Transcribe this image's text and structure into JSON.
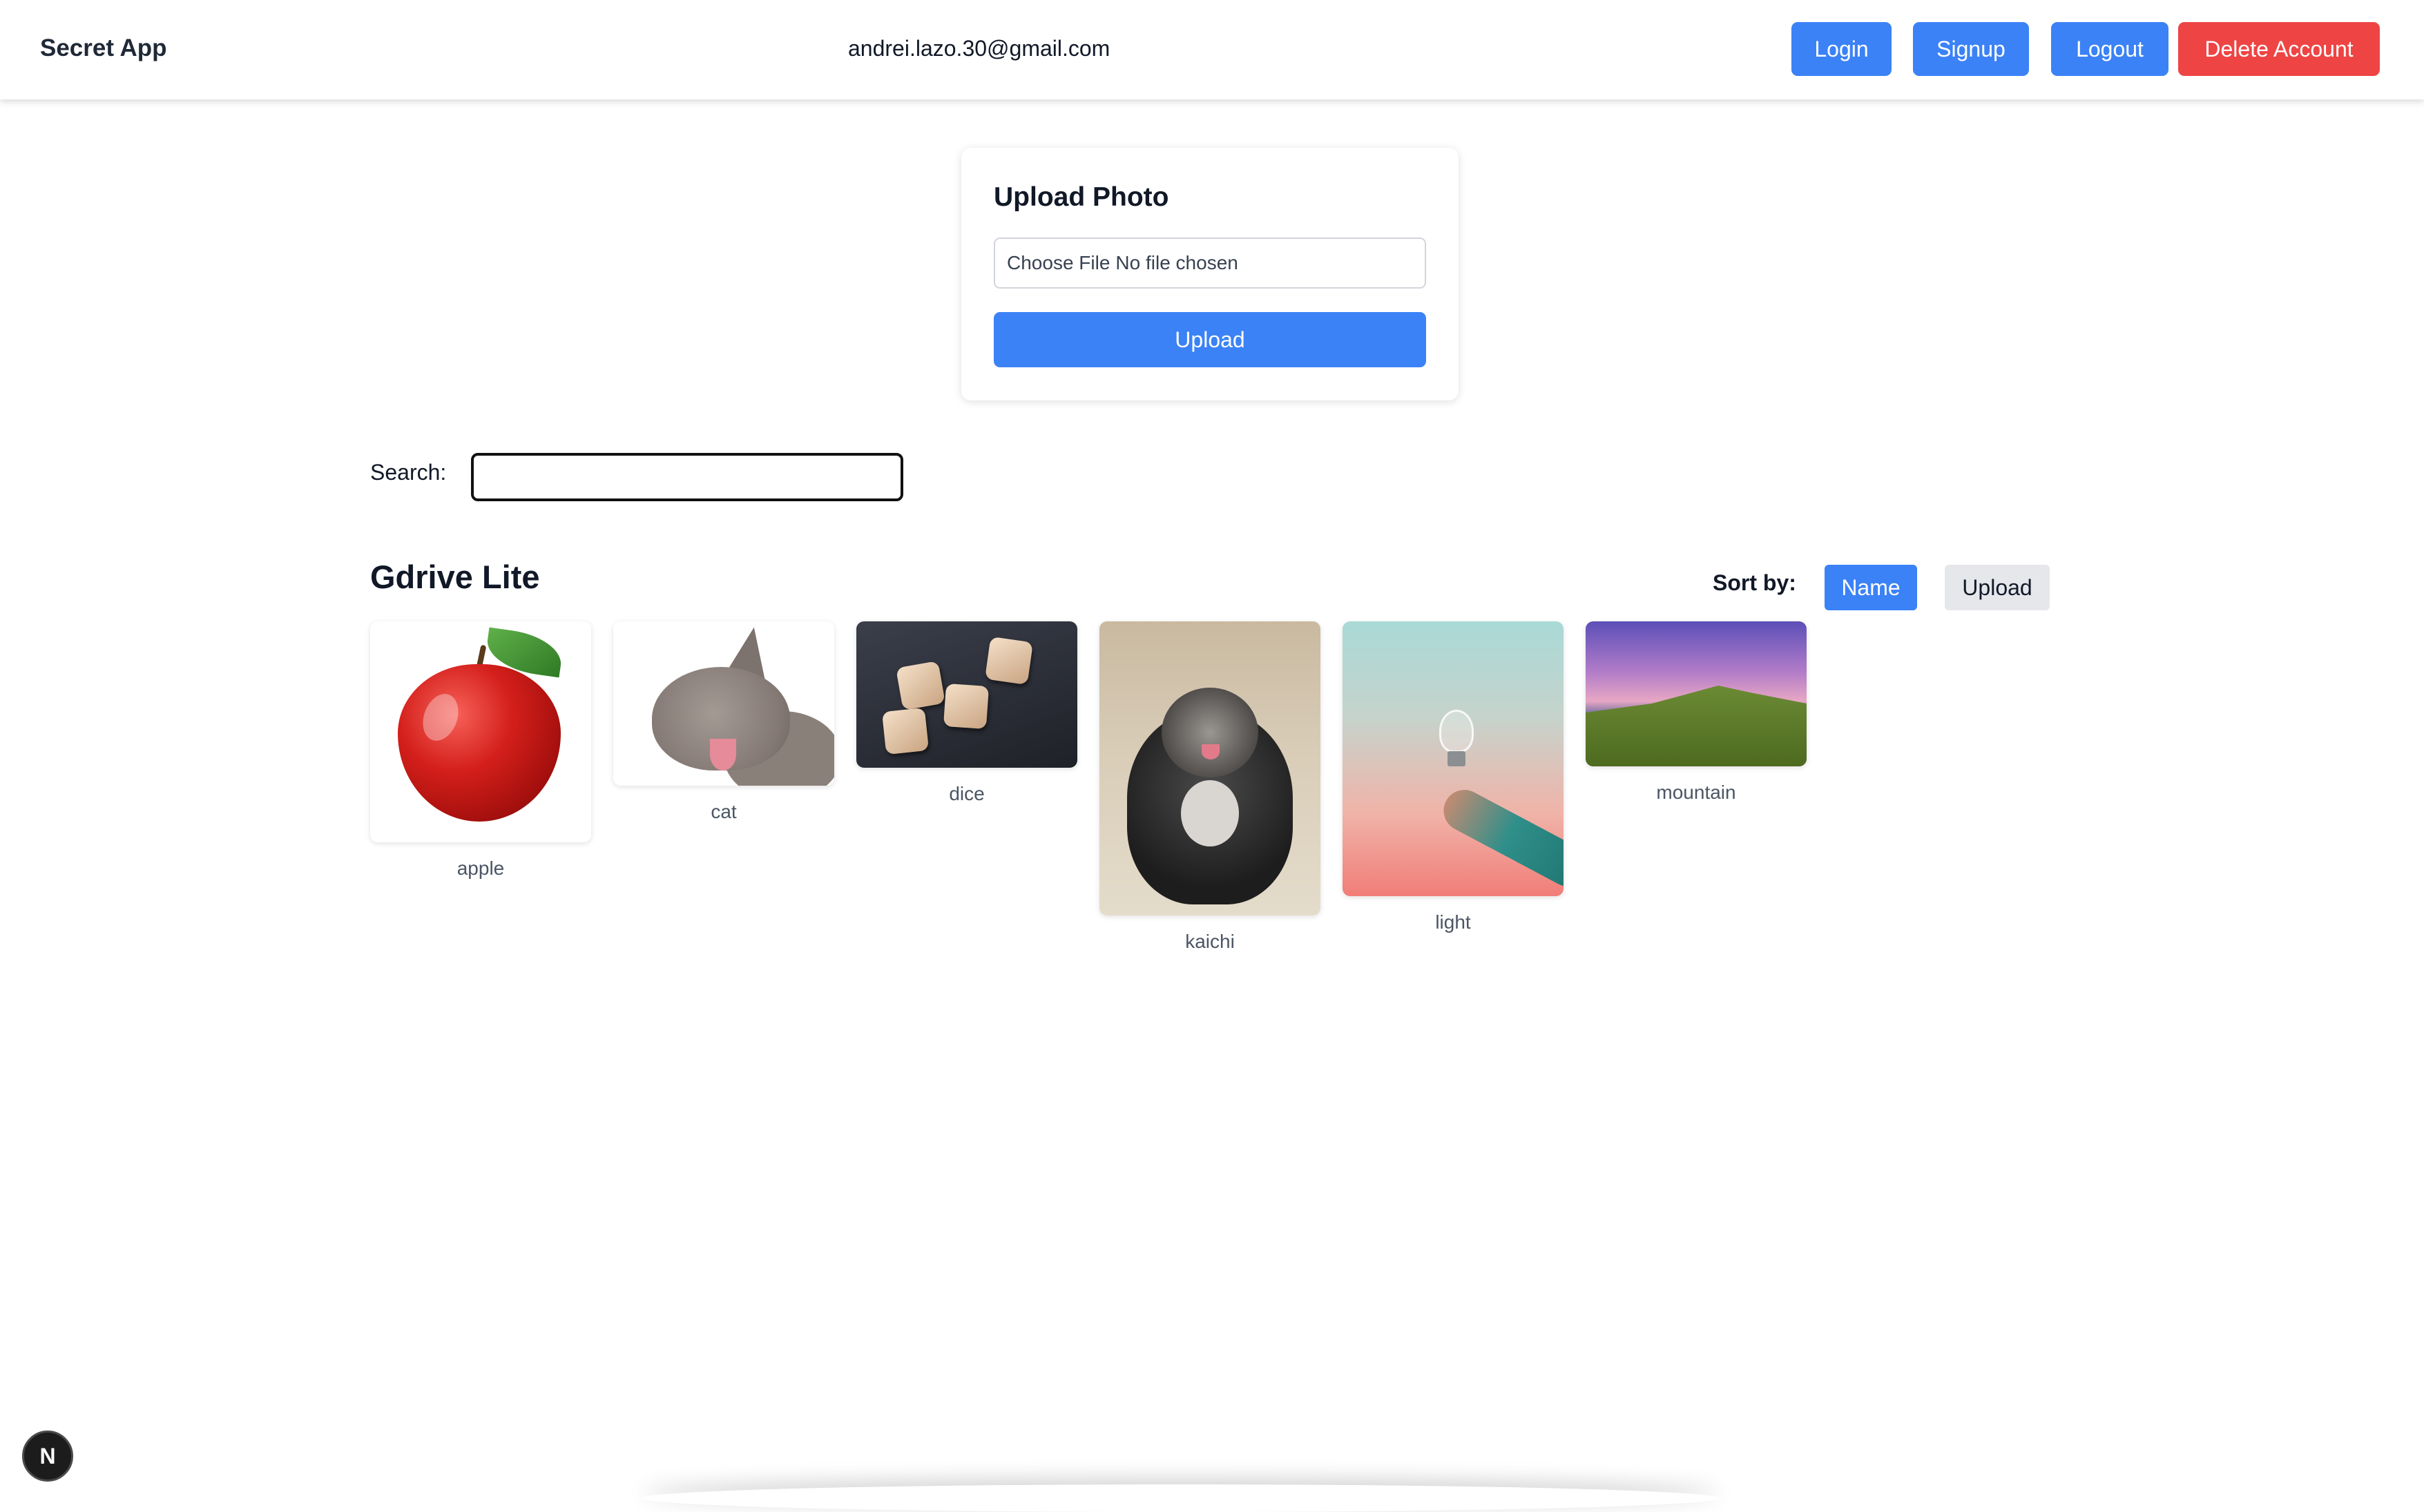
{
  "navbar": {
    "brand": "Secret App",
    "user_email": "andrei.lazo.30@gmail.com",
    "buttons": {
      "login": "Login",
      "signup": "Signup",
      "logout": "Logout",
      "delete_account": "Delete Account"
    }
  },
  "upload": {
    "title": "Upload Photo",
    "file_choose": "Choose File",
    "file_status": "No file chosen",
    "button": "Upload"
  },
  "search": {
    "label": "Search:",
    "value": ""
  },
  "gallery": {
    "title": "Gdrive Lite",
    "sort_label": "Sort by:",
    "sort_options": [
      "Name",
      "Upload"
    ],
    "sort_selected": "Name",
    "photos": [
      {
        "label": "apple"
      },
      {
        "label": "cat"
      },
      {
        "label": "dice"
      },
      {
        "label": "kaichi"
      },
      {
        "label": "light"
      },
      {
        "label": "mountain"
      }
    ]
  },
  "dev_indicator": "N",
  "colors": {
    "primary": "#3b82f6",
    "danger": "#ef4444",
    "sort_inactive": "#e5e7eb"
  }
}
